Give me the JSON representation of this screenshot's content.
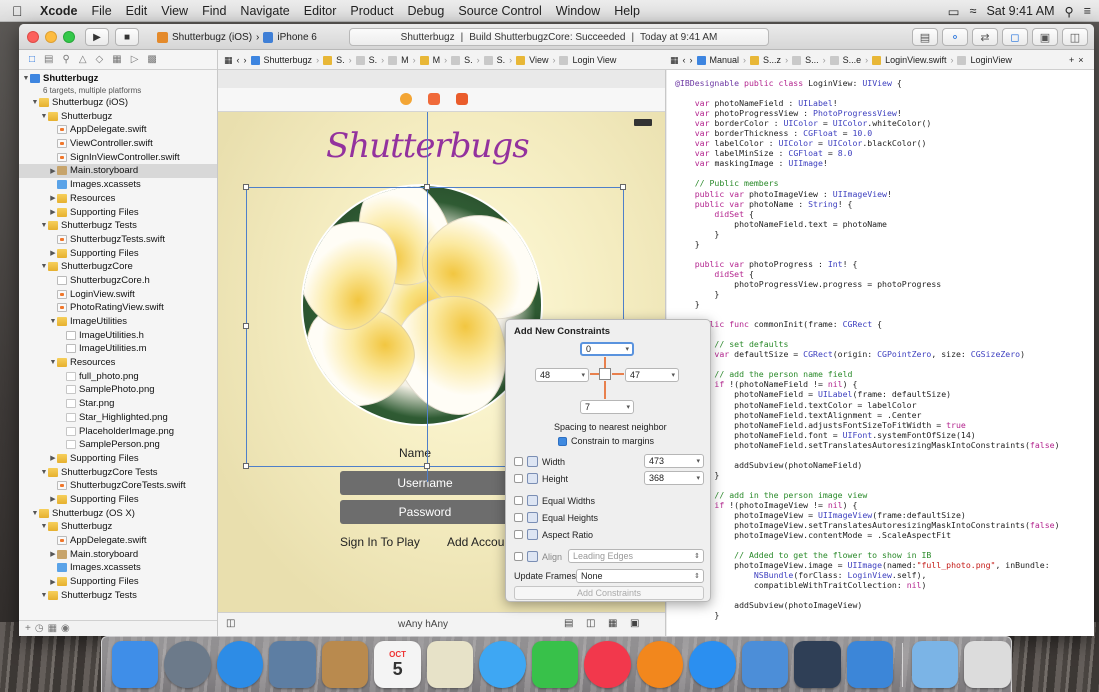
{
  "menubar": {
    "apple_icon": "apple-logo",
    "items": [
      "Xcode",
      "File",
      "Edit",
      "View",
      "Find",
      "Navigate",
      "Editor",
      "Product",
      "Debug",
      "Source Control",
      "Window",
      "Help"
    ],
    "clock": "Sat 9:41 AM",
    "icons": [
      "airplay-icon",
      "wifi-icon",
      "spotlight-icon",
      "notification-center-icon"
    ]
  },
  "toolbar": {
    "run_icon": "play-icon",
    "stop_icon": "stop-icon",
    "scheme": "Shutterbugz (iOS)",
    "device": "iPhone 6",
    "status_project": "Shutterbugz",
    "status_text": "Build ShutterbugzCore: Succeeded",
    "status_time": "Today at 9:41 AM"
  },
  "navigator": {
    "tabs": [
      "folder-icon",
      "symbol-icon",
      "search-icon",
      "issue-icon",
      "test-icon",
      "debug-icon",
      "breakpoint-icon",
      "report-icon"
    ],
    "items": [
      {
        "label": "Shutterbugz",
        "sub": "6 targets, multiple platforms",
        "icon": "proj",
        "indent": 0,
        "tri": "▼",
        "bold": true
      },
      {
        "label": "Shutterbugz (iOS)",
        "icon": "folder",
        "indent": 1,
        "tri": "▼"
      },
      {
        "label": "Shutterbugz",
        "icon": "folder",
        "indent": 2,
        "tri": "▼"
      },
      {
        "label": "AppDelegate.swift",
        "icon": "swift",
        "indent": 3,
        "tri": ""
      },
      {
        "label": "ViewController.swift",
        "icon": "swift",
        "indent": 3,
        "tri": ""
      },
      {
        "label": "SignInViewController.swift",
        "icon": "swift",
        "indent": 3,
        "tri": ""
      },
      {
        "label": "Main.storyboard",
        "icon": "story",
        "indent": 3,
        "tri": "▶",
        "sel": true
      },
      {
        "label": "Images.xcassets",
        "icon": "assets",
        "indent": 3,
        "tri": ""
      },
      {
        "label": "Resources",
        "icon": "folder",
        "indent": 3,
        "tri": "▶"
      },
      {
        "label": "Supporting Files",
        "icon": "folder",
        "indent": 3,
        "tri": "▶"
      },
      {
        "label": "Shutterbugz Tests",
        "icon": "folder",
        "indent": 2,
        "tri": "▼"
      },
      {
        "label": "ShutterbugzTests.swift",
        "icon": "swift",
        "indent": 3,
        "tri": ""
      },
      {
        "label": "Supporting Files",
        "icon": "folder",
        "indent": 3,
        "tri": "▶"
      },
      {
        "label": "ShutterbugzCore",
        "icon": "folder",
        "indent": 2,
        "tri": "▼"
      },
      {
        "label": "ShutterbugzCore.h",
        "icon": "h",
        "indent": 3,
        "tri": ""
      },
      {
        "label": "LoginView.swift",
        "icon": "swift",
        "indent": 3,
        "tri": ""
      },
      {
        "label": "PhotoRatingView.swift",
        "icon": "swift",
        "indent": 3,
        "tri": ""
      },
      {
        "label": "ImageUtilities",
        "icon": "folder",
        "indent": 3,
        "tri": "▼"
      },
      {
        "label": "ImageUtilities.h",
        "icon": "h",
        "indent": 4,
        "tri": ""
      },
      {
        "label": "ImageUtilities.m",
        "icon": "m",
        "indent": 4,
        "tri": ""
      },
      {
        "label": "Resources",
        "icon": "folder",
        "indent": 3,
        "tri": "▼"
      },
      {
        "label": "full_photo.png",
        "icon": "png",
        "indent": 4,
        "tri": ""
      },
      {
        "label": "SamplePhoto.png",
        "icon": "png",
        "indent": 4,
        "tri": ""
      },
      {
        "label": "Star.png",
        "icon": "png",
        "indent": 4,
        "tri": ""
      },
      {
        "label": "Star_Highlighted.png",
        "icon": "png",
        "indent": 4,
        "tri": ""
      },
      {
        "label": "PlaceholderImage.png",
        "icon": "png",
        "indent": 4,
        "tri": ""
      },
      {
        "label": "SamplePerson.png",
        "icon": "png",
        "indent": 4,
        "tri": ""
      },
      {
        "label": "Supporting Files",
        "icon": "folder",
        "indent": 3,
        "tri": "▶"
      },
      {
        "label": "ShutterbugzCore Tests",
        "icon": "folder",
        "indent": 2,
        "tri": "▼"
      },
      {
        "label": "ShutterbugzCoreTests.swift",
        "icon": "swift",
        "indent": 3,
        "tri": ""
      },
      {
        "label": "Supporting Files",
        "icon": "folder",
        "indent": 3,
        "tri": "▶"
      },
      {
        "label": "Shutterbugz (OS X)",
        "icon": "folder",
        "indent": 1,
        "tri": "▼"
      },
      {
        "label": "Shutterbugz",
        "icon": "folder",
        "indent": 2,
        "tri": "▼"
      },
      {
        "label": "AppDelegate.swift",
        "icon": "swift",
        "indent": 3,
        "tri": ""
      },
      {
        "label": "Main.storyboard",
        "icon": "story",
        "indent": 3,
        "tri": "▶"
      },
      {
        "label": "Images.xcassets",
        "icon": "assets",
        "indent": 3,
        "tri": ""
      },
      {
        "label": "Supporting Files",
        "icon": "folder",
        "indent": 3,
        "tri": "▶"
      },
      {
        "label": "Shutterbugz Tests",
        "icon": "folder",
        "indent": 2,
        "tri": "▼"
      }
    ]
  },
  "jumpbar_left": {
    "crumbs": [
      "Shutterbugz",
      "S.",
      "S.",
      "M",
      "M",
      "S.",
      "S.",
      "View",
      "Login View"
    ]
  },
  "jumpbar_right": {
    "crumbs": [
      "Manual",
      "S...z",
      "S...",
      "S...e",
      "LoginView.swift",
      "LoginView"
    ],
    "add_icon": "plus-icon",
    "close_icon": "close-icon"
  },
  "storyboard": {
    "logo_text": "Shutterbugs",
    "name_label": "Name",
    "username": "Username",
    "password": "Password",
    "sign_in": "Sign In To Play",
    "add_account": "Add Accou",
    "size_class": "wAny hAny"
  },
  "constraints": {
    "title": "Add New Constraints",
    "top": "0",
    "left": "48",
    "right": "47",
    "bottom": "7",
    "spacing_label": "Spacing to nearest neighbor",
    "constrain_margins": "Constrain to margins",
    "width_label": "Width",
    "width_value": "473",
    "height_label": "Height",
    "height_value": "368",
    "equal_widths": "Equal Widths",
    "equal_heights": "Equal Heights",
    "aspect_ratio": "Aspect Ratio",
    "align_label": "Align",
    "align_value": "Leading Edges",
    "update_frames_label": "Update Frames",
    "update_frames_value": "None",
    "add_button": "Add Constraints"
  },
  "code": [
    [
      [
        "at",
        "@IBDesignable "
      ],
      [
        "kw",
        "public class "
      ],
      [
        "",
        "LoginView: "
      ],
      [
        "ty",
        "UIView"
      ],
      [
        "",
        " {"
      ]
    ],
    [
      [
        "",
        ""
      ]
    ],
    [
      [
        "kw",
        "    var "
      ],
      [
        "",
        "photoNameField : "
      ],
      [
        "ty",
        "UILabel"
      ],
      [
        "",
        "!"
      ]
    ],
    [
      [
        "kw",
        "    var "
      ],
      [
        "",
        "photoProgressView : "
      ],
      [
        "ty",
        "PhotoProgressView"
      ],
      [
        "",
        "!"
      ]
    ],
    [
      [
        "kw",
        "    var "
      ],
      [
        "",
        "borderColor : "
      ],
      [
        "ty",
        "UIColor"
      ],
      [
        "",
        " = "
      ],
      [
        "ty",
        "UIColor"
      ],
      [
        "",
        ".whiteColor()"
      ]
    ],
    [
      [
        "kw",
        "    var "
      ],
      [
        "",
        "borderThickness : "
      ],
      [
        "ty",
        "CGFloat"
      ],
      [
        "",
        " = "
      ],
      [
        "ty",
        "10.0"
      ]
    ],
    [
      [
        "kw",
        "    var "
      ],
      [
        "",
        "labelColor : "
      ],
      [
        "ty",
        "UIColor"
      ],
      [
        "",
        " = "
      ],
      [
        "ty",
        "UIColor"
      ],
      [
        "",
        ".blackColor()"
      ]
    ],
    [
      [
        "kw",
        "    var "
      ],
      [
        "",
        "labelMinSize : "
      ],
      [
        "ty",
        "CGFloat"
      ],
      [
        "",
        " = "
      ],
      [
        "ty",
        "8.0"
      ]
    ],
    [
      [
        "kw",
        "    var "
      ],
      [
        "",
        "maskingImage : "
      ],
      [
        "ty",
        "UIImage"
      ],
      [
        "",
        "!"
      ]
    ],
    [
      [
        "",
        ""
      ]
    ],
    [
      [
        "cm",
        "    // Public members"
      ]
    ],
    [
      [
        "kw",
        "    public var "
      ],
      [
        "",
        "photoImageView : "
      ],
      [
        "ty",
        "UIImageView"
      ],
      [
        "",
        "!"
      ]
    ],
    [
      [
        "kw",
        "    public var "
      ],
      [
        "",
        "photoName : "
      ],
      [
        "ty",
        "String"
      ],
      [
        "",
        "! {"
      ]
    ],
    [
      [
        "kw",
        "        didSet "
      ],
      [
        "",
        "{"
      ]
    ],
    [
      [
        "",
        "            photoNameField.text = photoName"
      ]
    ],
    [
      [
        "",
        "        }"
      ]
    ],
    [
      [
        "",
        "    }"
      ]
    ],
    [
      [
        "",
        ""
      ]
    ],
    [
      [
        "kw",
        "    public var "
      ],
      [
        "",
        "photoProgress : "
      ],
      [
        "ty",
        "Int"
      ],
      [
        "",
        "! {"
      ]
    ],
    [
      [
        "kw",
        "        didSet "
      ],
      [
        "",
        "{"
      ]
    ],
    [
      [
        "",
        "            photoProgressView.progress = photoProgress"
      ]
    ],
    [
      [
        "",
        "        }"
      ]
    ],
    [
      [
        "",
        "    }"
      ]
    ],
    [
      [
        "",
        ""
      ]
    ],
    [
      [
        "kw",
        "    public func "
      ],
      [
        "",
        "commonInit(frame: "
      ],
      [
        "ty",
        "CGRect"
      ],
      [
        "",
        " {"
      ]
    ],
    [
      [
        "",
        ""
      ]
    ],
    [
      [
        "cm",
        "        // set defaults"
      ]
    ],
    [
      [
        "kw",
        "        var "
      ],
      [
        "",
        "defaultSize = "
      ],
      [
        "ty",
        "CGRect"
      ],
      [
        "",
        "(origin: "
      ],
      [
        "ty",
        "CGPointZero"
      ],
      [
        "",
        ", size: "
      ],
      [
        "ty",
        "CGSizeZero"
      ],
      [
        "",
        ")"
      ]
    ],
    [
      [
        "",
        ""
      ]
    ],
    [
      [
        "cm",
        "        // add the person name field"
      ]
    ],
    [
      [
        "kw",
        "        if "
      ],
      [
        "",
        "!(photoNameField != "
      ],
      [
        "kw",
        "nil"
      ],
      [
        "",
        ") {"
      ]
    ],
    [
      [
        "",
        "            photoNameField = "
      ],
      [
        "ty",
        "UILabel"
      ],
      [
        "",
        "(frame: defaultSize)"
      ]
    ],
    [
      [
        "",
        "            photoNameField.textColor = labelColor"
      ]
    ],
    [
      [
        "",
        "            photoNameField.textAlignment = .Center"
      ]
    ],
    [
      [
        "",
        "            photoNameField.adjustsFontSizeToFitWidth = "
      ],
      [
        "kw",
        "true"
      ]
    ],
    [
      [
        "",
        "            photoNameField.font = "
      ],
      [
        "ty",
        "UIFont"
      ],
      [
        "",
        ".systemFontOfSize(14)"
      ]
    ],
    [
      [
        "",
        "            photoNameField.setTranslatesAutoresizingMaskIntoConstraints("
      ],
      [
        "kw",
        "false"
      ],
      [
        "",
        ")"
      ]
    ],
    [
      [
        "",
        ""
      ]
    ],
    [
      [
        "",
        "            addSubview(photoNameField)"
      ]
    ],
    [
      [
        "",
        "        }"
      ]
    ],
    [
      [
        "",
        ""
      ]
    ],
    [
      [
        "cm",
        "        // add in the person image view"
      ]
    ],
    [
      [
        "kw",
        "        if "
      ],
      [
        "",
        "!(photoImageView != "
      ],
      [
        "kw",
        "nil"
      ],
      [
        "",
        ") {"
      ]
    ],
    [
      [
        "",
        "            photoImageView = "
      ],
      [
        "ty",
        "UIImageView"
      ],
      [
        "",
        "(frame:defaultSize)"
      ]
    ],
    [
      [
        "",
        "            photoImageView.setTranslatesAutoresizingMaskIntoConstraints("
      ],
      [
        "kw",
        "false"
      ],
      [
        "",
        ")"
      ]
    ],
    [
      [
        "",
        "            photoImageView.contentMode = .ScaleAspectFit"
      ]
    ],
    [
      [
        "",
        ""
      ]
    ],
    [
      [
        "cm",
        "            // Added to get the flower to show in IB"
      ]
    ],
    [
      [
        "",
        "            photoImageView.image = "
      ],
      [
        "ty",
        "UIImage"
      ],
      [
        "",
        "(named:"
      ],
      [
        "st",
        "\"full_photo.png\""
      ],
      [
        "",
        ", inBundle:"
      ]
    ],
    [
      [
        "",
        "                "
      ],
      [
        "ty",
        "NSBundle"
      ],
      [
        "",
        "(forClass: "
      ],
      [
        "ty",
        "LoginView"
      ],
      [
        "",
        ".self),"
      ]
    ],
    [
      [
        "",
        "                compatibleWithTraitCollection: "
      ],
      [
        "kw",
        "nil"
      ],
      [
        "",
        ")"
      ]
    ],
    [
      [
        "",
        ""
      ]
    ],
    [
      [
        "",
        "            addSubview(photoImageView)"
      ]
    ],
    [
      [
        "",
        "        }"
      ]
    ]
  ],
  "dock": [
    {
      "name": "finder-icon",
      "color": "#3f8ee8"
    },
    {
      "name": "launchpad-icon",
      "color": "#6c7a8a",
      "round": true
    },
    {
      "name": "safari-icon",
      "color": "#2d8ce6",
      "round": true
    },
    {
      "name": "preview-icon",
      "color": "#5d7ea3"
    },
    {
      "name": "contacts-icon",
      "color": "#b98a4e"
    },
    {
      "name": "calendar-icon",
      "color": "#f4f4f4",
      "text": "5",
      "month": "OCT"
    },
    {
      "name": "photos-icon",
      "color": "#e7e2c8"
    },
    {
      "name": "messages-icon",
      "color": "#3ea7f3",
      "round": true
    },
    {
      "name": "facetime-icon",
      "color": "#38c14a"
    },
    {
      "name": "itunes-icon",
      "color": "#f2384c",
      "round": true
    },
    {
      "name": "ibooks-icon",
      "color": "#f2871d",
      "round": true
    },
    {
      "name": "app-store-icon",
      "color": "#2b8ff0",
      "round": true
    },
    {
      "name": "xcode-icon",
      "color": "#4c8ed8"
    },
    {
      "name": "instruments-icon",
      "color": "#2f3f56"
    },
    {
      "name": "ios-simulator-icon",
      "color": "#3c86d8"
    },
    {
      "sep": true
    },
    {
      "name": "downloads-folder-icon",
      "color": "#7bb4e6"
    },
    {
      "name": "trash-icon",
      "color": "#dcdcdc"
    }
  ]
}
